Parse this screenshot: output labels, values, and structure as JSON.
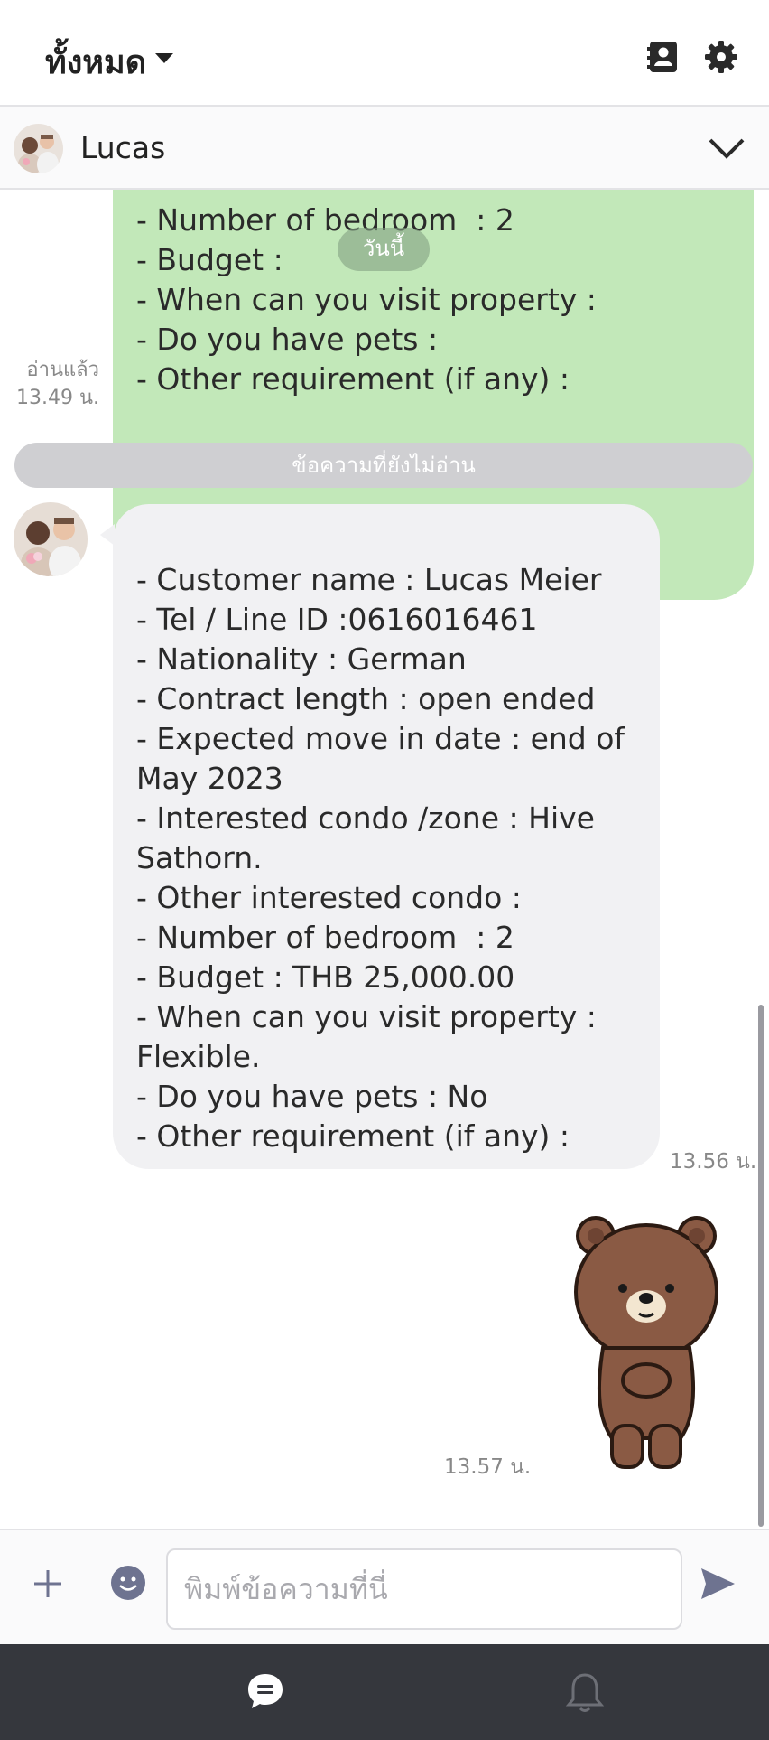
{
  "top_bar": {
    "filter_label": "ทั้งหมด",
    "icons": [
      "chevron-down-icon",
      "contact-book-icon",
      "gear-icon"
    ]
  },
  "chat_header": {
    "contact_name": "Lucas"
  },
  "messages": {
    "date_separator": "วันนี้",
    "outgoing_partial_text": "- Number of bedroom  : 2\n- Budget :\n- When can you visit property :\n- Do you have pets :\n- Other requirement (if any) :",
    "read_status": "อ่านแล้ว",
    "read_time": "13.49 น.",
    "unread_divider": "ข้อความที่ยังไม่อ่าน",
    "incoming_text": "- Customer name : Lucas Meier\n- Tel / Line ID :0616016461\n- Nationality : German\n- Contract length : open ended\n- Expected move in date : end of May 2023\n- Interested condo /zone : Hive Sathorn.\n- Other interested condo :\n- Number of bedroom  : 2\n- Budget : THB 25,000.00\n- When can you visit property : Flexible.\n- Do you have pets : No\n- Other requirement (if any) :",
    "incoming_time": "13.56 น.",
    "sticker_name": "brown-bear-sticker",
    "sticker_time": "13.57 น."
  },
  "composer": {
    "placeholder": "พิมพ์ข้อความที่นี่",
    "value": ""
  },
  "bottom_nav": {
    "items": [
      "chat-icon",
      "bell-icon"
    ]
  },
  "colors": {
    "outgoing_bubble": "#c2e8b9",
    "incoming_bubble": "#f1f1f3",
    "bottom_nav_bg": "#35373d",
    "icon_accent": "#6e7390"
  }
}
